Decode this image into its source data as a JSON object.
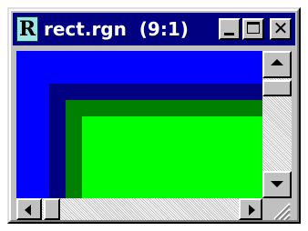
{
  "window": {
    "title": "rect.rgn  (9:1)",
    "app_icon": {
      "name": "region-editor-icon",
      "letter": "R"
    },
    "colors": {
      "titlebar_active": "#000080",
      "face": "#c0c0c0"
    },
    "caption_buttons": {
      "minimize": "minimize-icon",
      "maximize": "maximize-icon",
      "close_glyph": "✕"
    }
  },
  "canvas": {
    "zoom": "9:1",
    "colors": {
      "outer": "#0000ff",
      "second": "#000080",
      "third": "#008000",
      "inner": "#00ff00"
    }
  },
  "scrollbars": {
    "vertical": {
      "up_icon": "arrow-up-icon",
      "down_icon": "arrow-down-icon"
    },
    "horizontal": {
      "left_icon": "arrow-left-icon",
      "right_icon": "arrow-right-icon"
    }
  }
}
